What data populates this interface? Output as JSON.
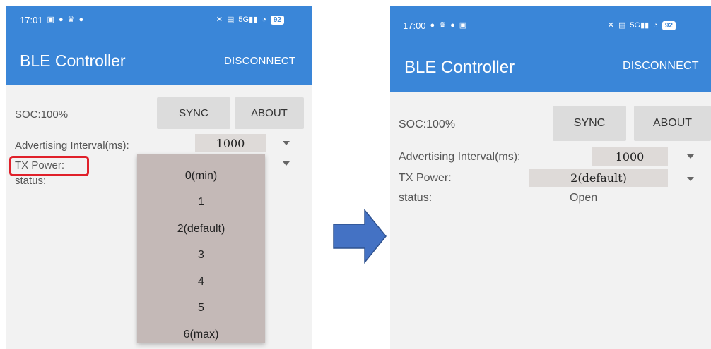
{
  "left_screen": {
    "status_bar": {
      "time": "17:01",
      "battery": "92",
      "network": "5G"
    },
    "app_title": "BLE Controller",
    "disconnect_label": "DISCONNECT",
    "soc_label": "SOC:100%",
    "sync_label": "SYNC",
    "about_label": "ABOUT",
    "adv_interval_label": "Advertising Interval(ms):",
    "adv_interval_value": "1000",
    "tx_power_label": "TX Power:",
    "status_label": "status:",
    "tx_power_options": [
      "0(min)",
      "1",
      "2(default)",
      "3",
      "4",
      "5",
      "6(max)"
    ]
  },
  "right_screen": {
    "status_bar": {
      "time": "17:00",
      "battery": "92",
      "network": "5G"
    },
    "app_title": "BLE Controller",
    "disconnect_label": "DISCONNECT",
    "soc_label": "SOC:100%",
    "sync_label": "SYNC",
    "about_label": "ABOUT",
    "adv_interval_label": "Advertising Interval(ms):",
    "adv_interval_value": "1000",
    "tx_power_label": "TX Power:",
    "tx_power_value": "2(default)",
    "status_label": "status:",
    "status_value": "Open"
  },
  "colors": {
    "app_bar": "#3a86d8",
    "highlight_box": "#e0202a",
    "dropdown_bg": "#c4b9b7",
    "arrow_fill": "#4472c4"
  }
}
